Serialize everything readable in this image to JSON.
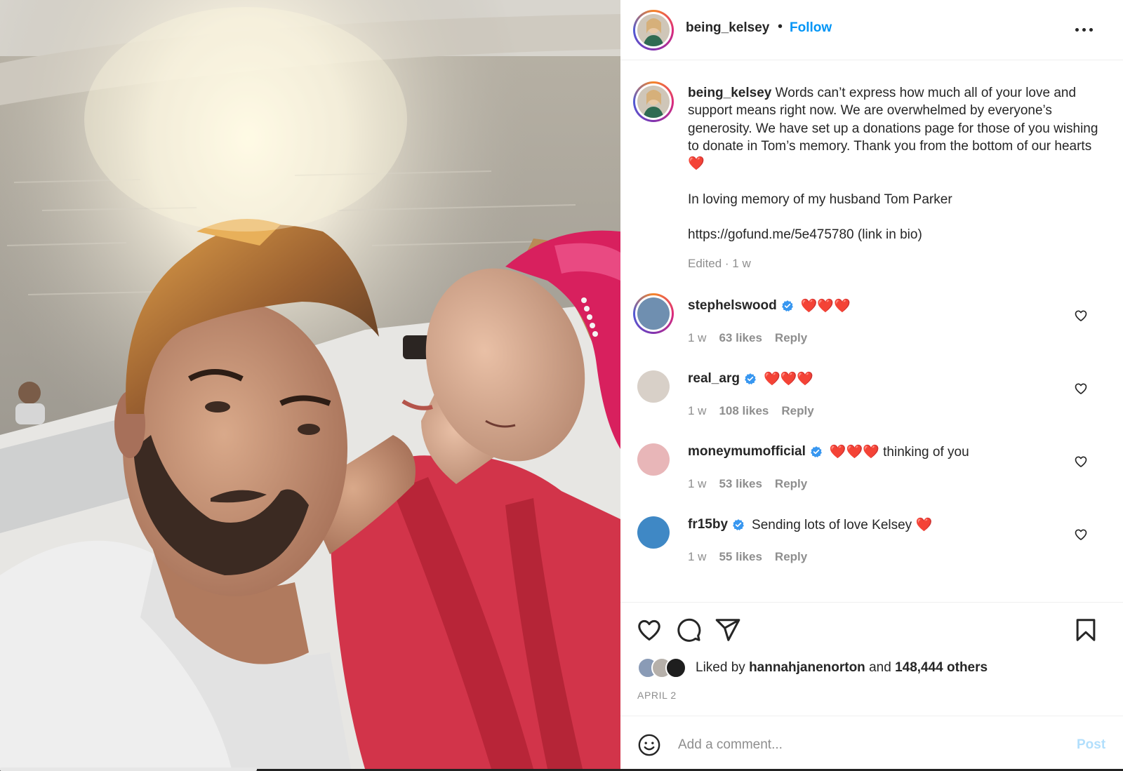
{
  "post": {
    "username": "being_kelsey",
    "separator": "•",
    "follow_label": "Follow",
    "more_label": "More options",
    "caption": {
      "username": "being_kelsey",
      "text": "Words can’t express how much all of your love and support means right now. We are overwhelmed by everyone’s generosity. We have set up a donations page for those of you wishing to donate in Tom’s memory. Thank you from the bottom of our hearts ❤️\n\nIn loving memory of my husband Tom Parker\n\nhttps://gofund.me/5e475780 (link in bio)",
      "meta": "Edited · 1 w"
    },
    "comments": [
      {
        "username": "stephelswood",
        "verified": true,
        "text": "❤️❤️❤️",
        "time": "1 w",
        "likes": "63 likes",
        "reply": "Reply",
        "story_ring": true,
        "avatar_color": "#6f8fb0"
      },
      {
        "username": "real_arg",
        "verified": true,
        "text": "❤️❤️❤️",
        "time": "1 w",
        "likes": "108 likes",
        "reply": "Reply",
        "story_ring": false,
        "avatar_color": "#d8d0c8"
      },
      {
        "username": "moneymumofficial",
        "verified": true,
        "text": "❤️❤️❤️ thinking of you",
        "time": "1 w",
        "likes": "53 likes",
        "reply": "Reply",
        "story_ring": false,
        "avatar_color": "#e8b6b8"
      },
      {
        "username": "fr15by",
        "verified": true,
        "text": "Sending lots of love Kelsey ❤️",
        "time": "1 w",
        "likes": "55 likes",
        "reply": "Reply",
        "story_ring": false,
        "avatar_color": "#3f88c5"
      }
    ],
    "liked_by": {
      "prefix": "Liked by",
      "user": "hannahjanenorton",
      "and": "and",
      "others": "148,444 others"
    },
    "date": "APRIL 2",
    "comment_input": {
      "placeholder": "Add a comment...",
      "post_label": "Post"
    }
  },
  "colors": {
    "link_blue": "#0095f6",
    "post_disabled": "#b2dffc",
    "meta_gray": "#8e8e8e",
    "text": "#262626",
    "verified_blue": "#3897f0"
  },
  "icons": [
    "more-icon",
    "like-icon",
    "comment-icon",
    "share-icon",
    "save-icon",
    "emoji-icon",
    "verified-icon",
    "heart-small-icon"
  ]
}
